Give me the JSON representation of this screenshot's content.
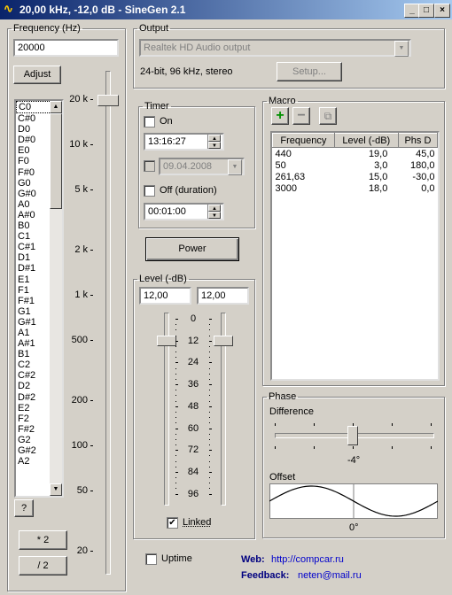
{
  "window": {
    "title": "20,00 kHz, -12,0 dB - SineGen 2.1"
  },
  "frequency": {
    "group_label": "Frequency (Hz)",
    "value": "20000",
    "adjust_label": "Adjust",
    "help_label": "?",
    "double_label": "* 2",
    "half_label": "/ 2",
    "notes": [
      "C0",
      "C#0",
      "D0",
      "D#0",
      "E0",
      "F0",
      "F#0",
      "G0",
      "G#0",
      "A0",
      "A#0",
      "B0",
      "C1",
      "C#1",
      "D1",
      "D#1",
      "E1",
      "F1",
      "F#1",
      "G1",
      "G#1",
      "A1",
      "A#1",
      "B1",
      "C2",
      "C#2",
      "D2",
      "D#2",
      "E2",
      "F2",
      "F#2",
      "G2",
      "G#2",
      "A2"
    ],
    "scale": [
      "20 k",
      "10 k",
      "5 k",
      "2 k",
      "1 k",
      "500",
      "200",
      "100",
      "50",
      "20"
    ]
  },
  "output": {
    "group_label": "Output",
    "device": "Realtek HD Audio output",
    "format": "24-bit, 96 kHz, stereo",
    "setup_label": "Setup..."
  },
  "timer": {
    "group_label": "Timer",
    "on_label": "On",
    "on_time": "13:16:27",
    "date": "09.04.2008",
    "off_label": "Off (duration)",
    "duration": "00:01:00"
  },
  "power_label": "Power",
  "level": {
    "group_label": "Level (-dB)",
    "left": "12,00",
    "right": "12,00",
    "scale": [
      "0",
      "12",
      "24",
      "36",
      "48",
      "60",
      "72",
      "84",
      "96"
    ],
    "linked_label": "Linked",
    "linked": true,
    "left_db": 12,
    "right_db": 12
  },
  "macro": {
    "group_label": "Macro",
    "columns": [
      "Frequency",
      "Level (-dB)",
      "Phs D"
    ],
    "rows": [
      [
        "440",
        "19,0",
        "45,0"
      ],
      [
        "50",
        "3,0",
        "180,0"
      ],
      [
        "261,63",
        "15,0",
        "-30,0"
      ],
      [
        "3000",
        "18,0",
        "0,0"
      ]
    ]
  },
  "phase": {
    "group_label": "Phase",
    "difference_label": "Difference",
    "difference_value": "-4°",
    "offset_label": "Offset",
    "offset_value": "0°"
  },
  "uptime_label": "Uptime",
  "web": {
    "label": "Web:",
    "url": "http://compcar.ru"
  },
  "feedback": {
    "label": "Feedback:",
    "email": "neten@mail.ru"
  }
}
